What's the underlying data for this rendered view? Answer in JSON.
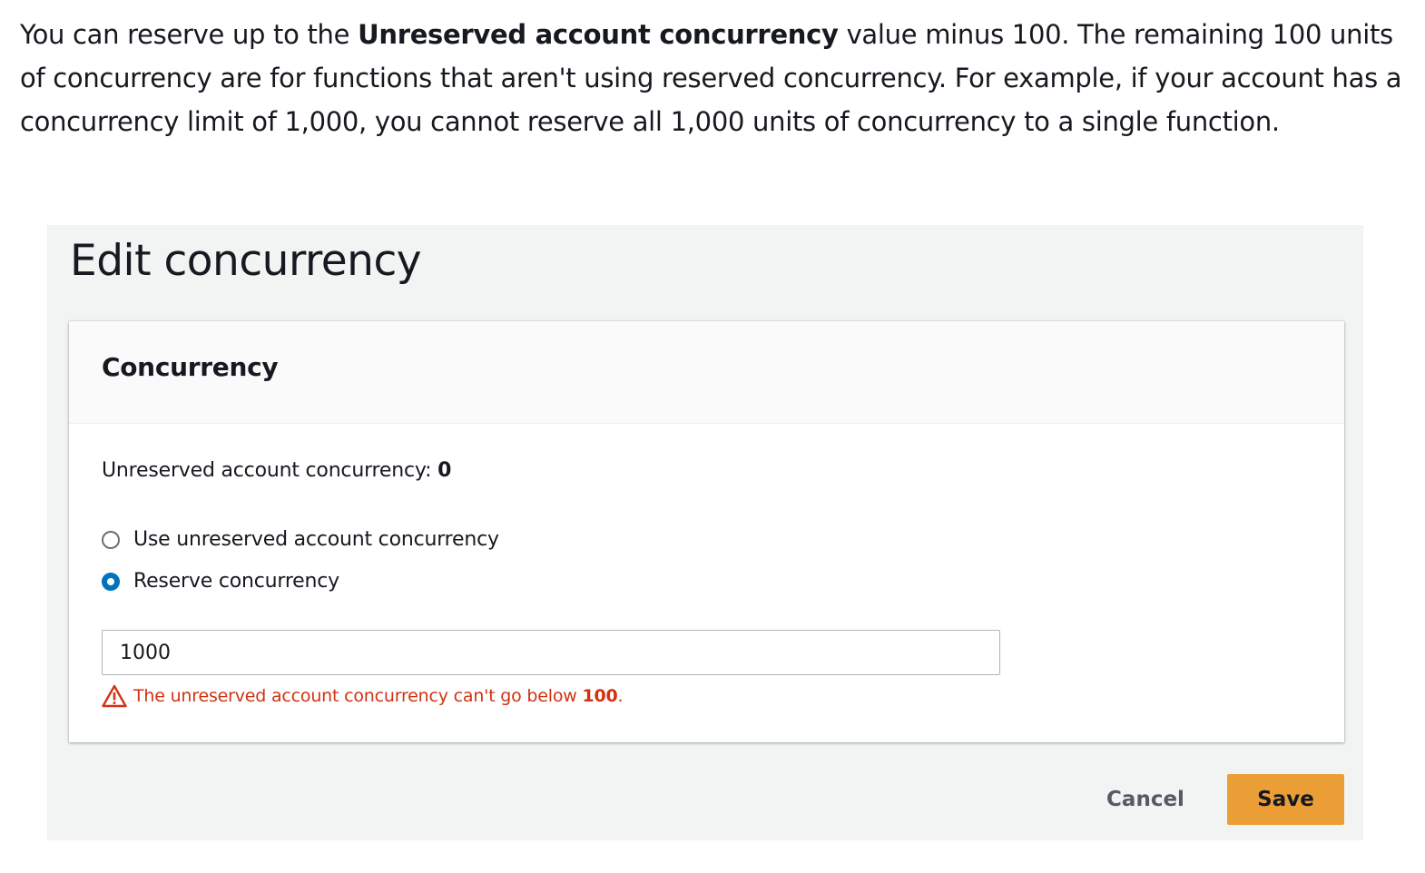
{
  "intro": {
    "prefix": "You can reserve up to the ",
    "bold": "Unreserved account concurrency",
    "suffix": " value minus 100. The remaining 100 units of concurrency are for functions that aren't using reserved concurrency. For example, if your account has a concurrency limit of 1,000, you cannot reserve all 1,000 units of concurrency to a single function."
  },
  "panel": {
    "title": "Edit concurrency"
  },
  "card": {
    "title": "Concurrency",
    "unreserved_label": "Unreserved account concurrency: ",
    "unreserved_value": "0",
    "options": [
      {
        "label": "Use unreserved account concurrency",
        "selected": false
      },
      {
        "label": "Reserve concurrency",
        "selected": true
      }
    ],
    "input_value": "1000",
    "error_prefix": "The unreserved account concurrency can't go below ",
    "error_value": "100",
    "error_suffix": "."
  },
  "actions": {
    "cancel_label": "Cancel",
    "save_label": "Save"
  },
  "colors": {
    "accent": "#0073bb",
    "error": "#d13212",
    "primary_button": "#ec9e36",
    "panel_background": "#f2f3f3"
  }
}
